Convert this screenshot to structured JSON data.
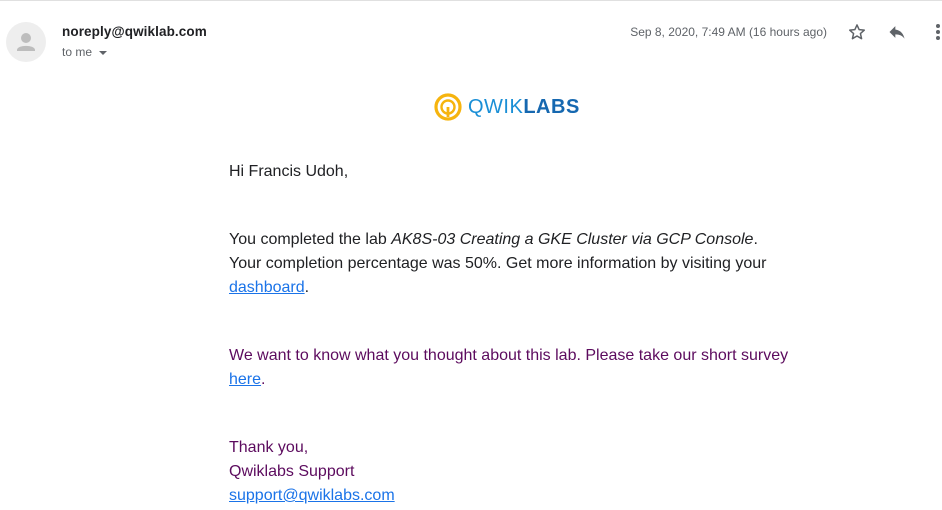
{
  "header": {
    "sender": "noreply@qwiklab.com",
    "recipient": "to me",
    "datetime": "Sep 8, 2020, 7:49 AM (16 hours ago)"
  },
  "icons": {
    "avatar": "person-avatar-icon",
    "star": "star-icon",
    "reply": "reply-icon",
    "more": "more-vert-icon"
  },
  "logo": {
    "part1": "QWIK",
    "part2": "LABS",
    "accent_color": "#f6b40e",
    "brand_color": "#1a8fd6"
  },
  "body": {
    "greeting": "Hi Francis Udoh,",
    "completion_prefix": "You completed the lab ",
    "lab_name": "AK8S-03 Creating a GKE Cluster via GCP Console",
    "completion_suffix": ". Your completion percentage was 50%. Get more information by visiting your ",
    "dashboard_link": "dashboard",
    "period1": ".",
    "survey_prefix": "We want to know what you thought about this lab. Please take our short survey ",
    "survey_link": "here",
    "period2": ".",
    "thanks": "Thank you,",
    "signature": "Qwiklabs Support",
    "support_email": "support@qwiklabs.com"
  }
}
